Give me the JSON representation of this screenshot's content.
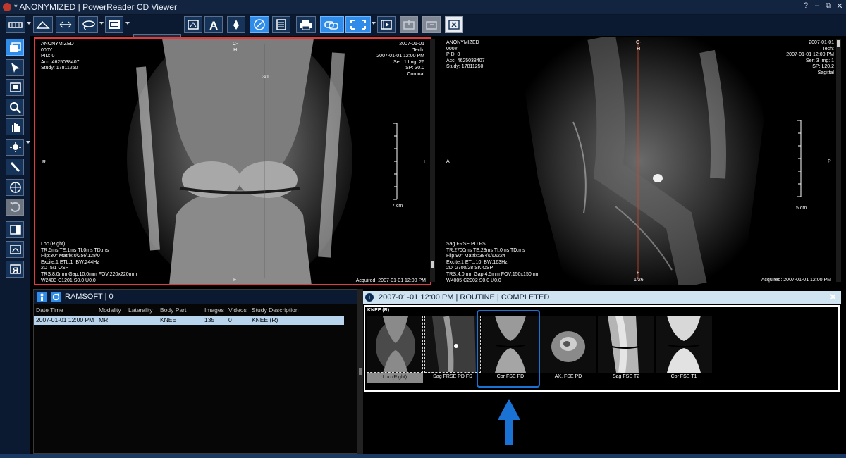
{
  "window": {
    "title": "* ANONYMIZED | PowerReader CD Viewer",
    "controls": [
      "?",
      "–",
      "⧉",
      "✕"
    ]
  },
  "toolbar": {
    "items": [
      "layout-icon",
      "annotation-icon",
      "measure-icon",
      "lasso-icon",
      "rect-icon",
      "window-level-select",
      "cine-icon",
      "text-icon",
      "arrow-marker-icon",
      "compass-icon",
      "report-icon",
      "print-icon",
      "link-icon",
      "fullscreen-icon",
      "movie-icon",
      "export-icon",
      "import-icon",
      "close-study-icon"
    ],
    "wl_value": ""
  },
  "sidebar": {
    "items": [
      "series-layout-icon",
      "pointer-icon",
      "invert-icon",
      "zoom-icon",
      "pan-icon",
      "window-level-icon",
      "probe-icon",
      "crosshair-icon",
      "rotate-icon",
      "flip-icon",
      "roi-icon",
      "mirror-icon"
    ]
  },
  "viewer_left": {
    "tl": "ANONYMIZED\n000Y\nPID: 0\nAcc: 4625038407\nStudy: 17811250",
    "tr": "2007-01-01\nTech:\n2007-01-01 12:00 PM\nSer: 1 Img: 26\nSP: 30.0\nCoronal",
    "bl": "Loc (Right)\nTR:5ms TE:1ms TI:0ms TD:ms\nFlip:30° Matrix:0\\256\\128\\0\nExcite:1 ETL:1  BW:244Hz\n2D  5/1 OSP\nTRS:8.0mm Gap:10.0mm FOV:220x220mm\nW2403 C1201 S0.0 U0.0",
    "br": "Acquired: 2007-01-01 12:00 PM",
    "top": "C-\nH",
    "left": "R",
    "right": "L",
    "bottom": "F",
    "scale": "7 cm",
    "label31": "3/1"
  },
  "viewer_right": {
    "tl": "ANONYMIZED\n000Y\nPID: 0\nAcc: 4625038407\nStudy: 17811250",
    "tr": "2007-01-01\nTech:\n2007-01-01 12:00 PM\nSer: 3 Img: 1\nSP: L20.2\nSagittal",
    "bl": "Sag FRSE PD FS\nTR:2700ms TE:28ms TI:0ms TD:ms\nFlip:90° Matrix:384\\0\\0\\224\nExcite:1 ETL:10  BW:163Hz\n2D  2700/28 SK OSP\nTRS:4.0mm Gap:4.5mm FOV:150x150mm\nW4005 C2002 S0.0 U0.0",
    "br": "Acquired: 2007-01-01 12:00 PM",
    "top": "C-\nH",
    "left": "A",
    "right": "P",
    "bottom": "F",
    "img_counter": "1/26",
    "scale": "5 cm"
  },
  "study_list": {
    "header": "RAMSOFT | 0",
    "columns": [
      "Date Time",
      "Modality",
      "Laterality",
      "Body Part",
      "Images",
      "Videos",
      "Study Description"
    ],
    "rows": [
      {
        "date": "2007-01-01 12:00 PM",
        "modality": "MR",
        "laterality": "",
        "body_part": "KNEE",
        "images": "135",
        "videos": "0",
        "description": "KNEE (R)"
      }
    ]
  },
  "series_panel": {
    "header": "2007-01-01 12:00 PM | ROUTINE | COMPLETED",
    "group": "KNEE (R)",
    "thumbs": [
      {
        "label": "Loc (Right)"
      },
      {
        "label": "Sag FRSE PD FS"
      },
      {
        "label": "Cor FSE PD"
      },
      {
        "label": "AX. FSE PD"
      },
      {
        "label": "Sag FSE T2"
      },
      {
        "label": "Cor FSE T1"
      }
    ],
    "highlighted": "Cor FSE PD"
  },
  "colors": {
    "accent": "#2f8ce8",
    "active_viewport_border": "#e23b3b",
    "highlight": "#1a73d4",
    "selected_row": "#b8d3ec"
  }
}
